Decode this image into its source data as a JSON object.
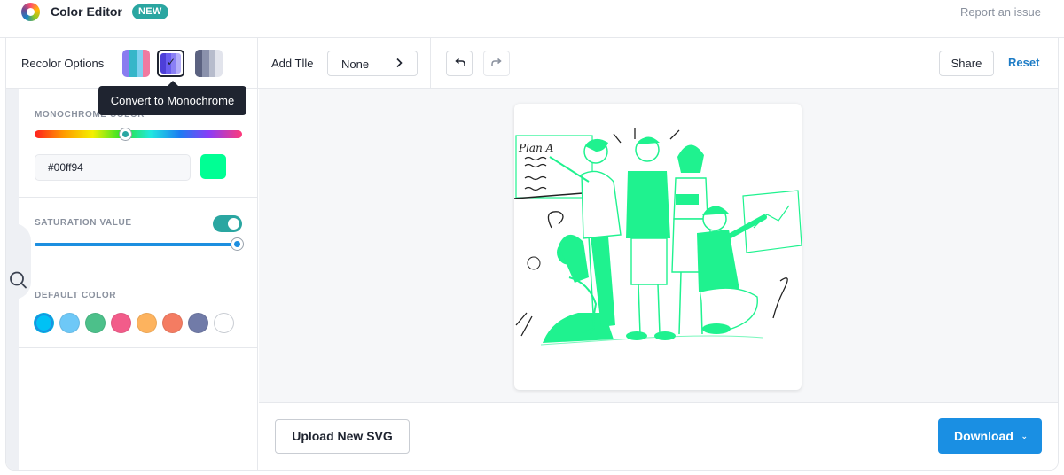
{
  "header": {
    "app_title": "Color Editor",
    "badge": "NEW",
    "report_link": "Report an issue"
  },
  "sidebar": {
    "recolor_label": "Recolor Options",
    "recolor_options": [
      {
        "name": "multicolor",
        "colors": [
          "#8a7cf0",
          "#36b6c9",
          "#7fd0f0",
          "#f07aa0"
        ]
      },
      {
        "name": "monochrome",
        "colors": [
          "#4d3fd8",
          "#6a5ef0",
          "#8a80f5",
          "#b4aef9"
        ],
        "selected": true
      },
      {
        "name": "grayscale",
        "colors": [
          "#5b6280",
          "#8a91ab",
          "#b7bccc",
          "#e2e4ec"
        ]
      }
    ],
    "tooltip": "Convert to Monochrome",
    "monochrome": {
      "label": "MONOCHROME COLOR",
      "hex_value": "#00ff94",
      "swatch_color": "#00ff94"
    },
    "saturation": {
      "label": "SATURATION VALUE",
      "enabled": true,
      "value": 100
    },
    "default_colors": {
      "label": "DEFAULT COLOR",
      "colors": [
        "#00c1f5",
        "#6ec8f7",
        "#4cc08a",
        "#f25c8a",
        "#fdb35e",
        "#f47c62",
        "#717ba8",
        "#ffffff"
      ],
      "selected_index": 0
    }
  },
  "toolbar": {
    "add_title_label": "Add Tlle",
    "title_value": "None",
    "undo_icon": "undo-icon",
    "redo_icon": "redo-icon",
    "share_label": "Share",
    "reset_label": "Reset"
  },
  "canvas": {
    "board_text": "Plan A",
    "accent_color": "#1ff28f"
  },
  "footer": {
    "upload_label": "Upload New SVG",
    "download_label": "Download"
  }
}
